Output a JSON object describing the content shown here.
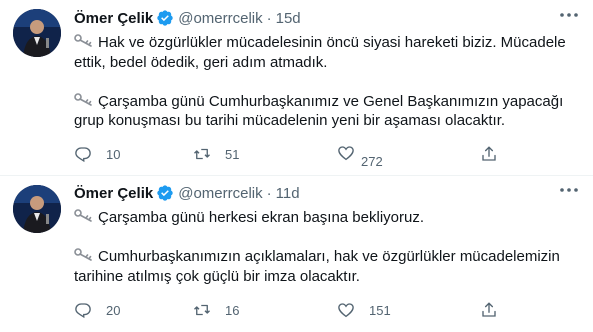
{
  "tweets": [
    {
      "name": "Ömer Çelik",
      "handle": "@omerrcelik",
      "separator": "·",
      "time": "15d",
      "paragraphs": [
        {
          "key": true,
          "text": "Hak ve özgürlükler mücadelesinin öncü siyasi hareketi biziz. Mücadele ettik, bedel ödedik, geri adım atmadık."
        },
        {
          "key": true,
          "text": "Çarşamba günü Cumhurbaşkanımız ve Genel Başkanımızın yapacağı grup konuşması bu tarihi mücadelenin yeni bir aşaması olacaktır."
        }
      ],
      "replies": "10",
      "retweets": "51",
      "likes": "272"
    },
    {
      "name": "Ömer Çelik",
      "handle": "@omerrcelik",
      "separator": "·",
      "time": "11d",
      "paragraphs": [
        {
          "key": true,
          "text": "Çarşamba günü herkesi ekran başına bekliyoruz."
        },
        {
          "key": true,
          "text": "Cumhurbaşkanımızın açıklamaları, hak ve özgürlükler mücadelemizin tarihine atılmış çok güçlü bir imza olacaktır."
        }
      ],
      "replies": "20",
      "retweets": "16",
      "likes": "151"
    }
  ],
  "icons": {
    "verified": "verified-badge-icon",
    "key": "old-key-icon",
    "reply": "reply-icon",
    "retweet": "retweet-icon",
    "like": "heart-icon",
    "share": "share-icon",
    "more": "more-dots-icon"
  },
  "colors": {
    "verified": "#1d9bf0",
    "secondary_text": "#536471",
    "text": "#0f1419"
  }
}
